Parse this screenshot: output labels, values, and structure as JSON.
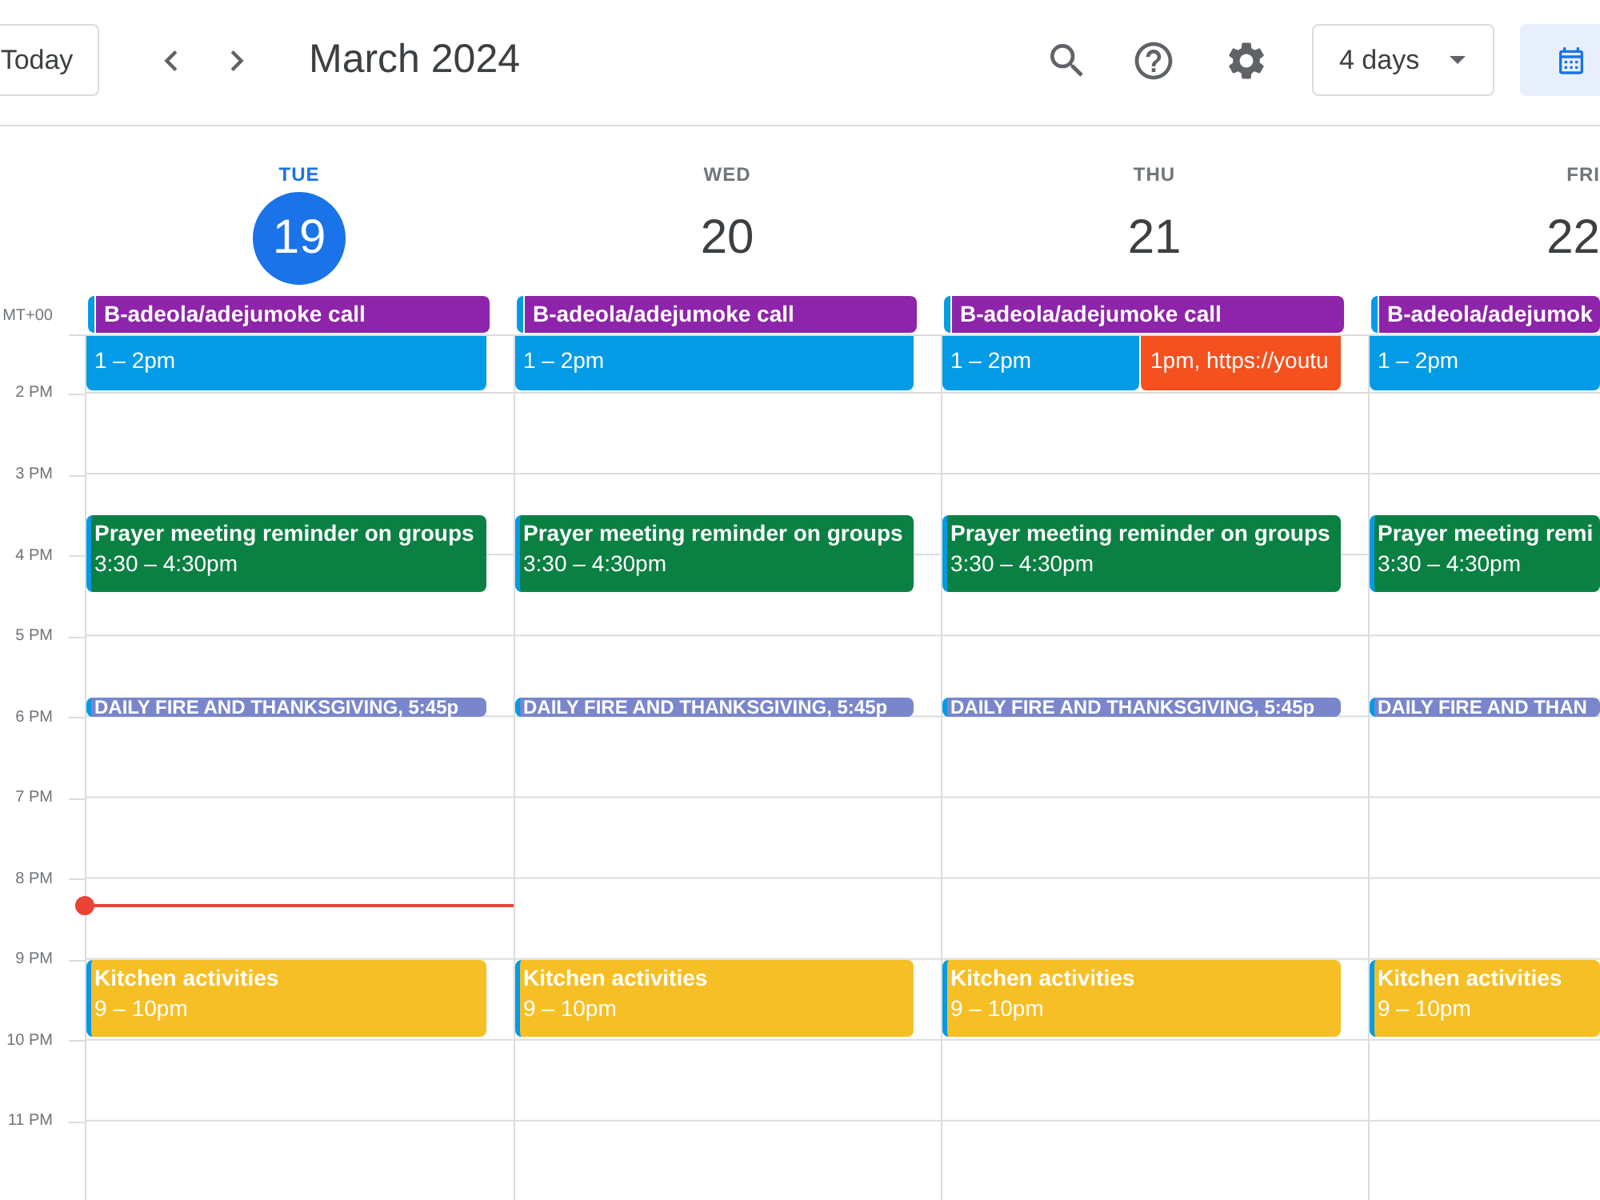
{
  "toolbar": {
    "today_button": "Today",
    "title": "March 2024",
    "view_select": "4 days"
  },
  "timezone": "MT+00",
  "hours": [
    "2 PM",
    "3 PM",
    "4 PM",
    "5 PM",
    "6 PM",
    "7 PM",
    "8 PM",
    "9 PM",
    "10 PM",
    "11 PM"
  ],
  "days": [
    {
      "name": "TUE",
      "number": "19",
      "today": true,
      "all_day": [
        {
          "title": "B-adeola/adejumoke call",
          "color": "#8e24aa"
        }
      ],
      "events": [
        {
          "kind": "standard",
          "details": "1 – 2pm",
          "overlap": false,
          "color": "#039be5"
        },
        {
          "kind": "standard",
          "title": "Prayer meeting reminder on groups",
          "details": "3:30 – 4:30pm",
          "overlap": false,
          "color": "#0b8043"
        },
        {
          "kind": "compact",
          "title": "DAILY FIRE AND THANKSGIVING, 5:45p",
          "overlap": false,
          "color": "#7986cb"
        },
        {
          "kind": "standard",
          "title": "Kitchen activities",
          "details": "9 – 10pm",
          "overlap": false,
          "color": "#f6bf26"
        }
      ]
    },
    {
      "name": "WED",
      "number": "20",
      "today": false,
      "all_day": [
        {
          "title": "B-adeola/adejumoke call",
          "color": "#8e24aa"
        }
      ],
      "events": [
        {
          "kind": "standard",
          "details": "1 – 2pm",
          "overlap": false,
          "color": "#039be5"
        },
        {
          "kind": "standard",
          "title": "Prayer meeting reminder on groups",
          "details": "3:30 – 4:30pm",
          "overlap": false,
          "color": "#0b8043"
        },
        {
          "kind": "compact",
          "title": "DAILY FIRE AND THANKSGIVING, 5:45p",
          "overlap": false,
          "color": "#7986cb"
        },
        {
          "kind": "standard",
          "title": "Kitchen activities",
          "details": "9 – 10pm",
          "overlap": false,
          "color": "#f6bf26"
        }
      ]
    },
    {
      "name": "THU",
      "number": "21",
      "today": false,
      "all_day": [
        {
          "title": "B-adeola/adejumoke call",
          "color": "#8e24aa"
        }
      ],
      "events": [
        {
          "kind": "standard",
          "details": "1 – 2pm",
          "overlap": false,
          "color": "#039be5"
        },
        {
          "kind": "standard",
          "details": "1pm, https://youtu",
          "overlap": true,
          "color": "#f4511e"
        },
        {
          "kind": "standard",
          "title": "Prayer meeting reminder on groups",
          "details": "3:30 – 4:30pm",
          "overlap": false,
          "color": "#0b8043"
        },
        {
          "kind": "compact",
          "title": "DAILY FIRE AND THANKSGIVING, 5:45p",
          "overlap": false,
          "color": "#7986cb"
        },
        {
          "kind": "standard",
          "title": "Kitchen activities",
          "details": "9 – 10pm",
          "overlap": false,
          "color": "#f6bf26"
        }
      ]
    },
    {
      "name": "FRI",
      "number": "22",
      "today": false,
      "all_day": [
        {
          "title": "B-adeola/adejumok",
          "color": "#8e24aa"
        }
      ],
      "events": [
        {
          "kind": "standard",
          "details": "1 – 2pm",
          "overlap": false,
          "color": "#039be5"
        },
        {
          "kind": "standard",
          "title": "Prayer meeting remi",
          "details": "3:30 – 4:30pm",
          "overlap": false,
          "color": "#0b8043"
        },
        {
          "kind": "compact",
          "title": "DAILY FIRE AND THAN",
          "overlap": false,
          "color": "#7986cb"
        },
        {
          "kind": "standard",
          "title": "Kitchen activities",
          "details": "9 – 10pm",
          "overlap": false,
          "color": "#f6bf26"
        }
      ]
    }
  ]
}
